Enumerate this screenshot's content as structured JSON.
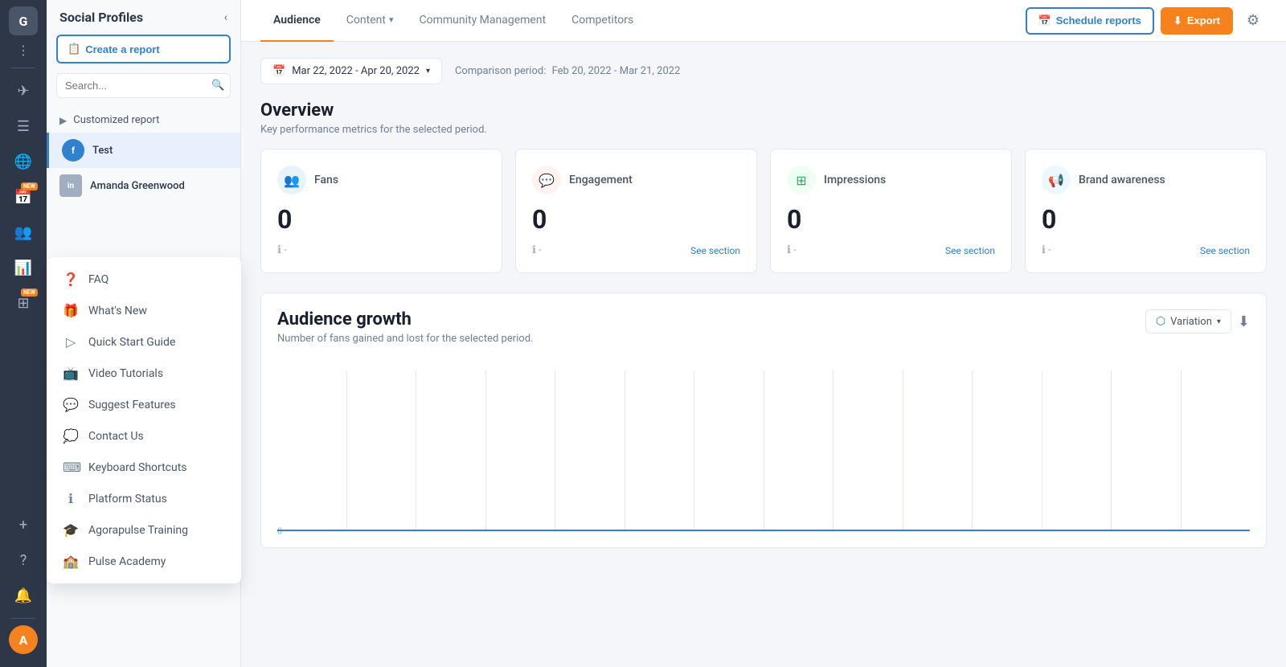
{
  "iconBar": {
    "avatarLetter": "G",
    "navIcons": [
      {
        "name": "send-icon",
        "symbol": "✈",
        "active": false,
        "hasNew": false
      },
      {
        "name": "inbox-icon",
        "symbol": "☰",
        "active": false,
        "hasNew": false
      },
      {
        "name": "globe-icon",
        "symbol": "🌐",
        "active": false,
        "hasNew": false
      },
      {
        "name": "calendar-icon",
        "symbol": "📅",
        "active": false,
        "hasNew": true
      },
      {
        "name": "people-icon",
        "symbol": "👥",
        "active": false,
        "hasNew": false
      },
      {
        "name": "chart-icon",
        "symbol": "📊",
        "active": true,
        "hasNew": false
      },
      {
        "name": "grid-icon",
        "symbol": "⊞",
        "active": false,
        "hasNew": false
      }
    ],
    "bottomIcons": [
      {
        "name": "plus-icon",
        "symbol": "+",
        "active": false
      },
      {
        "name": "help-icon",
        "symbol": "?",
        "active": false
      },
      {
        "name": "bell-icon",
        "symbol": "🔔",
        "active": false
      }
    ]
  },
  "sidebar": {
    "title": "Social Profiles",
    "createReportLabel": "Create a report",
    "searchPlaceholder": "Search...",
    "customizedReport": "Customized report",
    "profiles": [
      {
        "name": "Test",
        "type": "facebook",
        "active": true
      },
      {
        "name": "Amanda Greenwood",
        "type": "linkedin",
        "active": false
      }
    ]
  },
  "helpMenu": {
    "items": [
      {
        "label": "FAQ",
        "icon": "❓",
        "name": "faq-item"
      },
      {
        "label": "What's New",
        "icon": "🎁",
        "name": "whats-new-item"
      },
      {
        "label": "Quick Start Guide",
        "icon": "▷",
        "name": "quick-start-item"
      },
      {
        "label": "Video Tutorials",
        "icon": "📺",
        "name": "video-tutorials-item"
      },
      {
        "label": "Suggest Features",
        "icon": "💬",
        "name": "suggest-features-item"
      },
      {
        "label": "Contact Us",
        "icon": "💭",
        "name": "contact-us-item"
      },
      {
        "label": "Keyboard Shortcuts",
        "icon": "⌨",
        "name": "keyboard-shortcuts-item"
      },
      {
        "label": "Platform Status",
        "icon": "ℹ",
        "name": "platform-status-item"
      },
      {
        "label": "Agorapulse Training",
        "icon": "🎓",
        "name": "agorapulse-training-item"
      },
      {
        "label": "Pulse Academy",
        "icon": "🏫",
        "name": "pulse-academy-item"
      }
    ]
  },
  "topNav": {
    "tabs": [
      {
        "label": "Audience",
        "active": true
      },
      {
        "label": "Content",
        "hasDropdown": true,
        "active": false
      },
      {
        "label": "Community Management",
        "active": false
      },
      {
        "label": "Competitors",
        "active": false
      }
    ],
    "scheduleReports": "Schedule reports",
    "export": "Export"
  },
  "dateBar": {
    "selectedRange": "Mar 22, 2022 - Apr 20, 2022",
    "comparisonLabel": "Comparison period:",
    "comparisonRange": "Feb 20, 2022 - Mar 21, 2022"
  },
  "overview": {
    "title": "Overview",
    "subtitle": "Key performance metrics for the selected period.",
    "metrics": [
      {
        "label": "Fans",
        "value": "0",
        "type": "fans",
        "icon": "👥",
        "showSection": false
      },
      {
        "label": "Engagement",
        "value": "0",
        "type": "engagement",
        "icon": "💬",
        "showSection": true
      },
      {
        "label": "Impressions",
        "value": "0",
        "type": "impressions",
        "icon": "⊞",
        "showSection": true
      },
      {
        "label": "Brand awareness",
        "value": "0",
        "type": "brand",
        "icon": "📢",
        "showSection": true
      }
    ],
    "seeSectionLabel": "See section"
  },
  "audienceGrowth": {
    "title": "Audience growth",
    "subtitle": "Number of fans gained and lost for the selected period.",
    "variationLabel": "Variation",
    "zeroLabel": "0",
    "chartColumns": 14
  }
}
